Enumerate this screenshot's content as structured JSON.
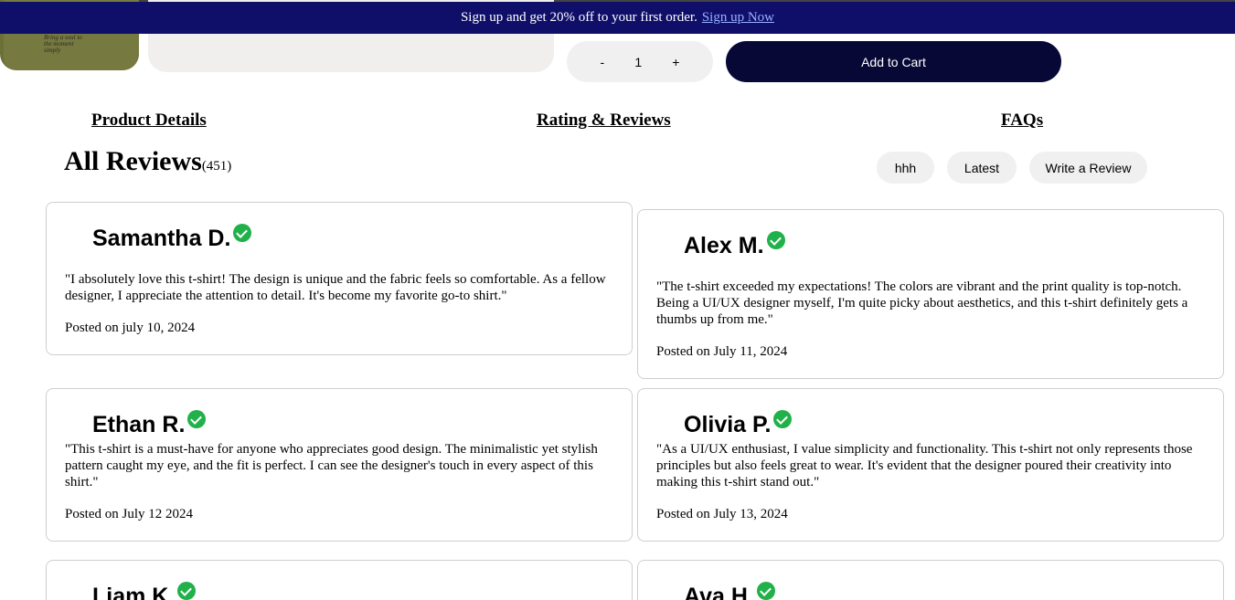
{
  "banner": {
    "text": "Sign up and get 20% off to your first order.",
    "link": "Sign up Now"
  },
  "product": {
    "shirt_print": "Bring a soul to the moment simply"
  },
  "quantity": {
    "minus": "-",
    "value": "1",
    "plus": "+"
  },
  "cart_button": "Add to Cart",
  "tabs": [
    "Product Details",
    "Rating & Reviews",
    "FAQs"
  ],
  "reviews_header": {
    "title": "All Reviews",
    "count": "(451)"
  },
  "filters": [
    "hhh",
    "Latest",
    "Write a Review"
  ],
  "reviews": [
    {
      "name": "Samantha D.",
      "text": "\"I absolutely love this t-shirt! The design is unique and the fabric feels so comfortable. As a fellow designer, I appreciate the attention to detail. It's become my favorite go-to shirt.\"",
      "date": "Posted on july 10, 2024"
    },
    {
      "name": "Alex M.",
      "text": "\"The t-shirt exceeded my expectations! The colors are vibrant and the print quality is top-notch. Being a UI/UX designer myself, I'm quite picky about aesthetics, and this t-shirt definitely gets a thumbs up from me.\"",
      "date": "Posted on July 11, 2024"
    },
    {
      "name": "Ethan R.",
      "text": "\"This t-shirt is a must-have for anyone who appreciates good design. The minimalistic yet stylish pattern caught my eye, and the fit is perfect. I can see the designer's touch in every aspect of this shirt.\"",
      "date": "Posted on July 12 2024"
    },
    {
      "name": "Olivia P.",
      "text": "\"As a UI/UX enthusiast, I value simplicity and functionality. This t-shirt not only represents those principles but also feels great to wear. It's evident that the designer poured their creativity into making this t-shirt stand out.\"",
      "date": "Posted on July 13, 2024"
    },
    {
      "name": "Liam K."
    },
    {
      "name": "Ava H."
    }
  ],
  "colors": {
    "banner": "#0f0f6a",
    "cart_button": "#080836",
    "verified": "#21b14a",
    "pill": "#f0f0f0"
  }
}
